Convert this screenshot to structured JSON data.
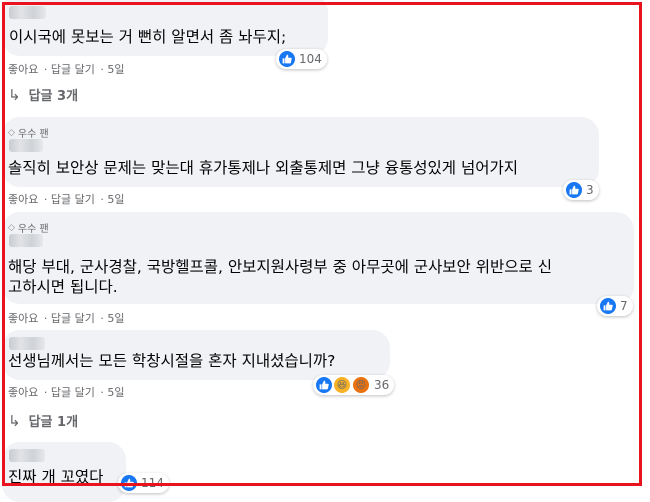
{
  "comments": [
    {
      "badge": "",
      "text_lines": [
        "이시국에 못보는 거 뻔히 알면서 좀 놔두지;"
      ],
      "reactions": [
        "like"
      ],
      "reaction_count": "104",
      "actions": {
        "like": "좋아요",
        "reply": "답글 달기",
        "time": "5일"
      },
      "replies_label": "답글 3개"
    },
    {
      "badge": "우수 팬",
      "text_lines": [
        "솔직히 보안상 문제는 맞는대 휴가통제나 외출통제면 그냥 융통성있게 넘어가지"
      ],
      "reactions": [
        "like"
      ],
      "reaction_count": "3",
      "actions": {
        "like": "좋아요",
        "reply": "답글 달기",
        "time": "5일"
      }
    },
    {
      "badge": "우수 팬",
      "text_lines": [
        "해당 부대, 군사경찰, 국방헬프콜, 안보지원사령부 중 아무곳에 군사보안 위반으로 신",
        "고하시면 됩니다."
      ],
      "reactions": [
        "like"
      ],
      "reaction_count": "7",
      "actions": {
        "like": "좋아요",
        "reply": "답글 달기",
        "time": "5일"
      }
    },
    {
      "badge": "",
      "text_lines": [
        "선생님께서는 모든 학창시절을 혼자 지내셨습니까?"
      ],
      "reactions": [
        "like",
        "haha",
        "angry"
      ],
      "reaction_count": "36",
      "actions": {
        "like": "좋아요",
        "reply": "답글 달기",
        "time": "5일"
      },
      "replies_label": "답글 1개"
    },
    {
      "badge": "",
      "text_lines": [
        "진짜 개 꼬였다"
      ],
      "reactions": [
        "like"
      ],
      "reaction_count": "114"
    }
  ],
  "colors": {
    "frame": "#e8131d",
    "bubble": "#f0f2f5",
    "like": "#1877f2",
    "meta": "#65676b"
  }
}
